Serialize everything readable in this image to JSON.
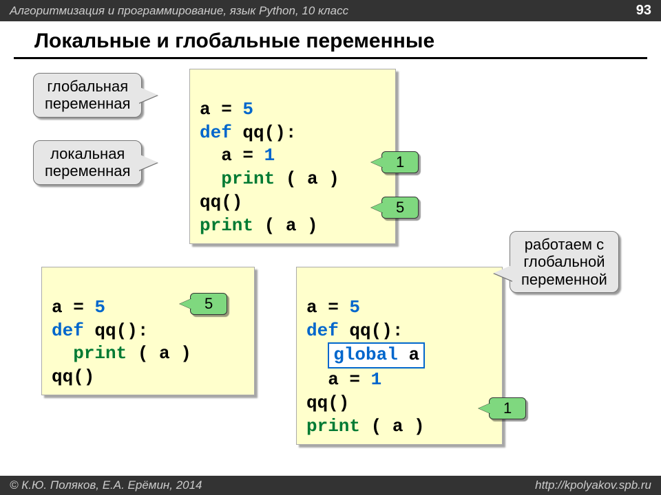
{
  "header": {
    "course": "Алгоритмизация и программирование, язык Python, 10 класс",
    "page": "93"
  },
  "title": "Локальные и глобальные переменные",
  "callouts": {
    "global_var": "глобальная\nпеременная",
    "local_var": "локальная\nпеременная",
    "work_global": "работаем с\nглобальной\nпеременной"
  },
  "code1": {
    "l1a": "a",
    "l1b": " = ",
    "l1c": "5",
    "l2a": "def",
    "l2b": " qq():",
    "l3a": "  a",
    "l3b": " = ",
    "l3c": "1",
    "l4a": "  ",
    "l4b": "print",
    "l4c": " ( a )",
    "l5": "qq()",
    "l6a": "print",
    "l6b": " ( a )"
  },
  "code2": {
    "l1a": "a",
    "l1b": " = ",
    "l1c": "5",
    "l2a": "def",
    "l2b": " qq():",
    "l3a": "  ",
    "l3b": "print",
    "l3c": " ( a )",
    "l4": "qq()"
  },
  "code3": {
    "l1a": "a",
    "l1b": " = ",
    "l1c": "5",
    "l2a": "def",
    "l2b": " qq():",
    "l3_indent": "  ",
    "l3_global": "global",
    "l3_a": " a",
    "l4a": "  a",
    "l4b": " = ",
    "l4c": "1",
    "l5": "qq()",
    "l6a": "print",
    "l6b": " ( a )"
  },
  "bubbles": {
    "b1": "1",
    "b5a": "5",
    "b5b": "5",
    "b1b": "1"
  },
  "footer": {
    "left": "© К.Ю. Поляков, Е.А. Ерёмин, 2014",
    "right": "http://kpolyakov.spb.ru"
  }
}
